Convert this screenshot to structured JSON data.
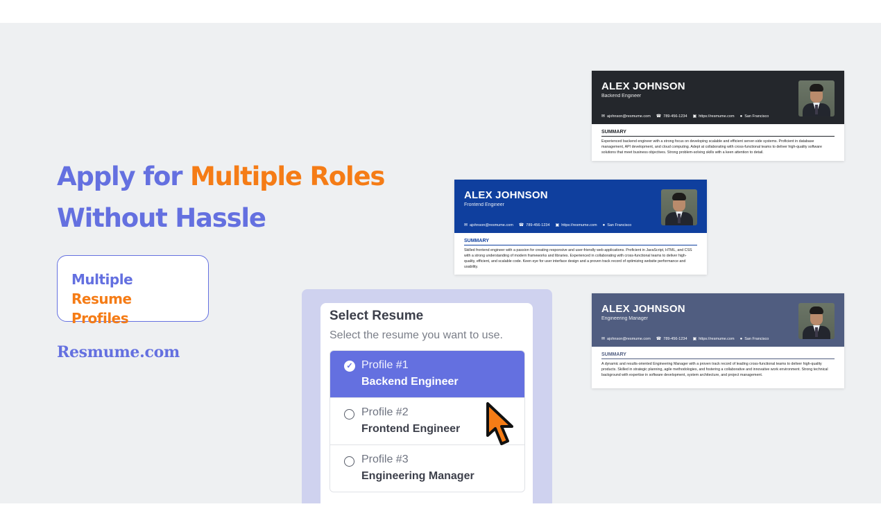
{
  "hero": {
    "line1_a": "Apply for ",
    "line1_b": "Multiple Roles",
    "line2": "Without Hassle"
  },
  "badge": {
    "part1": "Multiple ",
    "part2": "Resume",
    "part3": "Profiles"
  },
  "brand": "Resmume.com",
  "colors": {
    "primary": "#6470e0",
    "accent": "#f57c16",
    "panel": "#cfd2ef"
  },
  "resumes": [
    {
      "name": "ALEX JOHNSON",
      "role": "Backend Engineer",
      "email": "ajohnson@resmume.com",
      "phone": "789-456-1234",
      "site": "https://resmume.com",
      "location": "San Francisco",
      "summary_title": "SUMMARY",
      "summary": "Experienced backend engineer with a strong focus on developing scalable and efficient server-side systems. Proficient in database management, API development, and cloud computing. Adept at collaborating with cross-functional teams to deliver high-quality software solutions that meet business objectives. Strong problem-solving skills with a keen attention to detail.",
      "header_color": "#24272c"
    },
    {
      "name": "ALEX JOHNSON",
      "role": "Frontend Engineer",
      "email": "ajohnson@resmume.com",
      "phone": "789-456-1234",
      "site": "https://resmume.com",
      "location": "San Francisco",
      "summary_title": "SUMMARY",
      "summary": "Skilled frontend engineer with a passion for creating responsive and user-friendly web applications. Proficient in JavaScript, HTML, and CSS with a strong understanding of modern frameworks and libraries. Experienced in collaborating with cross-functional teams to deliver high-quality, efficient, and scalable code. Keen eye for user interface design and a proven track record of optimizing website performance and usability.",
      "header_color": "#0f3f9e"
    },
    {
      "name": "ALEX JOHNSON",
      "role": "Engineering Manager",
      "email": "ajohnson@resmume.com",
      "phone": "789-456-1234",
      "site": "https://resmume.com",
      "location": "San Francisco",
      "summary_title": "SUMMARY",
      "summary": "A dynamic and results-oriented Engineering Manager with a proven track record of leading cross-functional teams to deliver high-quality products. Skilled in strategic planning, agile methodologies, and fostering a collaborative and innovative work environment. Strong technical background with expertise in software development, system architecture, and project management.",
      "header_color": "#505d80"
    }
  ],
  "selector": {
    "title": "Select Resume",
    "subtitle": "Select the resume you want to use.",
    "options": [
      {
        "label": "Profile #1",
        "role": "Backend Engineer",
        "selected": true
      },
      {
        "label": "Profile #2",
        "role": "Frontend Engineer",
        "selected": false
      },
      {
        "label": "Profile #3",
        "role": "Engineering Manager",
        "selected": false
      }
    ]
  },
  "icons": {
    "email": "envelope-icon",
    "phone": "phone-icon",
    "site": "link-icon",
    "location": "map-pin-icon",
    "selected": "check-circle-icon",
    "unselected": "radio-empty-icon",
    "cursor": "pointer-cursor-icon"
  }
}
